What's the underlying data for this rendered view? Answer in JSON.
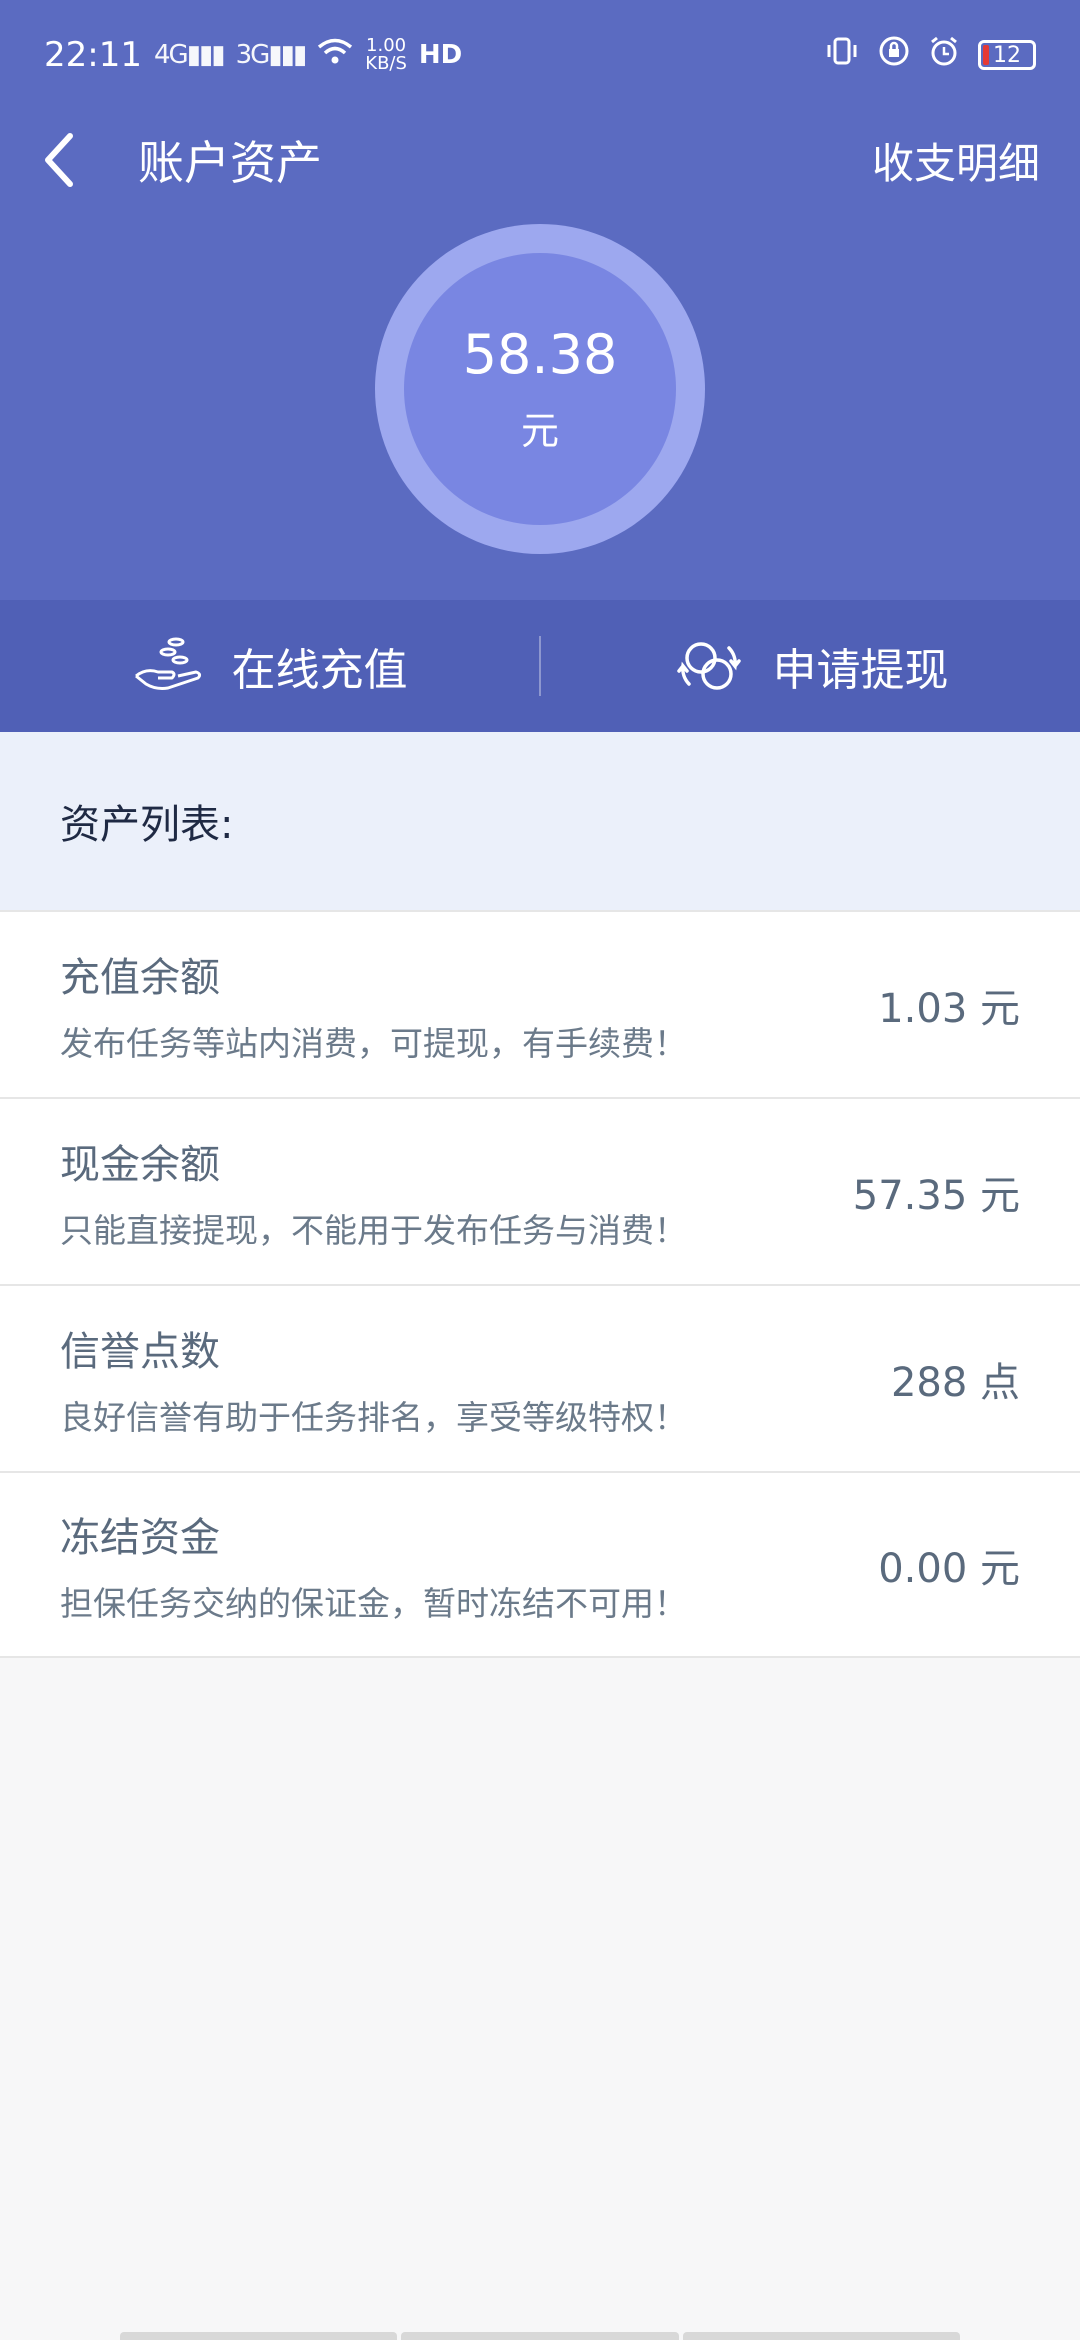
{
  "status": {
    "time": "22:11",
    "signal1": "4G",
    "signal2": "3G",
    "netspeed_value": "1.00",
    "netspeed_unit": "KB/S",
    "hd": "HD",
    "battery": "12"
  },
  "header": {
    "title": "账户资产",
    "detail_link": "收支明细"
  },
  "balance": {
    "amount": "58.38",
    "unit": "元"
  },
  "actions": {
    "recharge": "在线充值",
    "withdraw": "申请提现"
  },
  "section": {
    "title": "资产列表:"
  },
  "assets": [
    {
      "title": "充值余额",
      "desc": "发布任务等站内消费，可提现，有手续费！",
      "value": "1.03 元"
    },
    {
      "title": "现金余额",
      "desc": "只能直接提现，不能用于发布任务与消费！",
      "value": "57.35 元"
    },
    {
      "title": "信誉点数",
      "desc": "良好信誉有助于任务排名，享受等级特权！",
      "value": "288 点"
    },
    {
      "title": "冻结资金",
      "desc": "担保任务交纳的保证金，暂时冻结不可用！",
      "value": "0.00 元"
    }
  ],
  "colors": {
    "primary": "#5b6bc1",
    "action_bar": "#5060b6",
    "ring_outer": "#9da8ef",
    "ring_inner": "#7986e2"
  }
}
